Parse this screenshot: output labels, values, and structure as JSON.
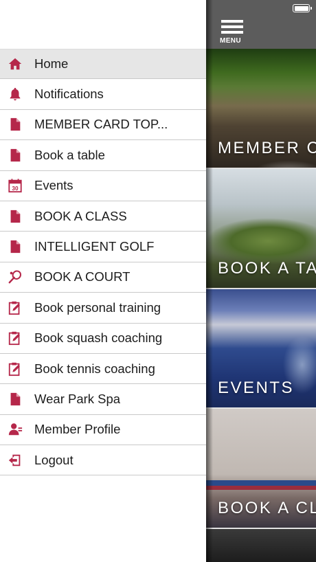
{
  "drawer": {
    "items": [
      {
        "label": "Home",
        "icon": "home-icon",
        "active": true
      },
      {
        "label": "Notifications",
        "icon": "bell-icon"
      },
      {
        "label": "MEMBER CARD TOP...",
        "icon": "document-icon"
      },
      {
        "label": "Book a table",
        "icon": "document-icon"
      },
      {
        "label": "Events",
        "icon": "calendar-icon"
      },
      {
        "label": "BOOK A CLASS",
        "icon": "document-icon"
      },
      {
        "label": "INTELLIGENT GOLF",
        "icon": "document-icon"
      },
      {
        "label": "BOOK A COURT",
        "icon": "racket-icon"
      },
      {
        "label": "Book personal training",
        "icon": "edit-icon"
      },
      {
        "label": "Book squash coaching",
        "icon": "edit-icon"
      },
      {
        "label": "Book tennis coaching",
        "icon": "edit-icon"
      },
      {
        "label": "Wear Park Spa",
        "icon": "document-icon"
      },
      {
        "label": "Member Profile",
        "icon": "user-icon"
      },
      {
        "label": "Logout",
        "icon": "logout-icon"
      }
    ]
  },
  "topbar": {
    "menu_label": "MENU",
    "status_icon": "battery-icon"
  },
  "tiles": [
    {
      "label": "MEMBER C"
    },
    {
      "label": "BOOK A TA"
    },
    {
      "label": "EVENTS"
    },
    {
      "label": "BOOK A CL"
    }
  ],
  "colors": {
    "accent": "#b5274a",
    "topbar": "#5c5c5c",
    "active_row": "#e6e6e6",
    "divider": "#c9c9c9"
  }
}
